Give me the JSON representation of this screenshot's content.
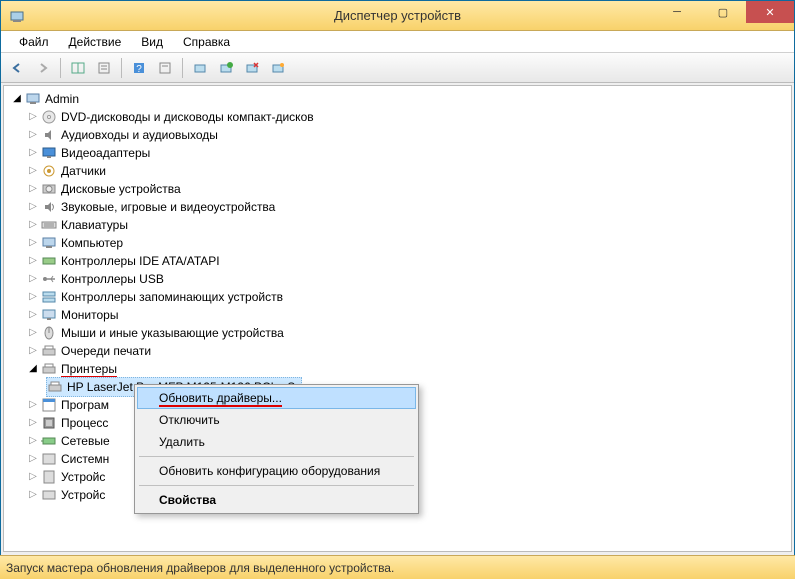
{
  "window": {
    "title": "Диспетчер устройств"
  },
  "menu": {
    "file": "Файл",
    "action": "Действие",
    "view": "Вид",
    "help": "Справка"
  },
  "tree": {
    "root": "Admin",
    "items": [
      {
        "label": "DVD-дисководы и дисководы компакт-дисков",
        "icon": "disc"
      },
      {
        "label": "Аудиовходы и аудиовыходы",
        "icon": "audio"
      },
      {
        "label": "Видеоадаптеры",
        "icon": "display"
      },
      {
        "label": "Датчики",
        "icon": "sensor"
      },
      {
        "label": "Дисковые устройства",
        "icon": "disk"
      },
      {
        "label": "Звуковые, игровые и видеоустройства",
        "icon": "sound"
      },
      {
        "label": "Клавиатуры",
        "icon": "keyboard"
      },
      {
        "label": "Компьютер",
        "icon": "computer"
      },
      {
        "label": "Контроллеры IDE ATA/ATAPI",
        "icon": "ide"
      },
      {
        "label": "Контроллеры USB",
        "icon": "usb"
      },
      {
        "label": "Контроллеры запоминающих устройств",
        "icon": "storage"
      },
      {
        "label": "Мониторы",
        "icon": "monitor"
      },
      {
        "label": "Мыши и иные указывающие устройства",
        "icon": "mouse"
      },
      {
        "label": "Очереди печати",
        "icon": "printqueue"
      }
    ],
    "printers": {
      "label": "Принтеры",
      "child": "HP LaserJet Pro MFP M125-M126 PCLmS"
    },
    "tail": [
      {
        "label": "Програм",
        "icon": "program",
        "partial": true
      },
      {
        "label": "Процесс",
        "icon": "cpu",
        "partial": true
      },
      {
        "label": "Сетевые",
        "icon": "network",
        "partial": true
      },
      {
        "label": "Системн",
        "icon": "system",
        "partial": true
      },
      {
        "label": "Устройс",
        "icon": "device",
        "partial": true
      },
      {
        "label": "Устройс",
        "icon": "hid",
        "partial": true
      }
    ]
  },
  "context_menu": {
    "update_drivers": "Обновить драйверы...",
    "disable": "Отключить",
    "delete": "Удалить",
    "scan_hardware": "Обновить конфигурацию оборудования",
    "properties": "Свойства"
  },
  "statusbar": {
    "text": "Запуск мастера обновления драйверов для выделенного устройства."
  }
}
